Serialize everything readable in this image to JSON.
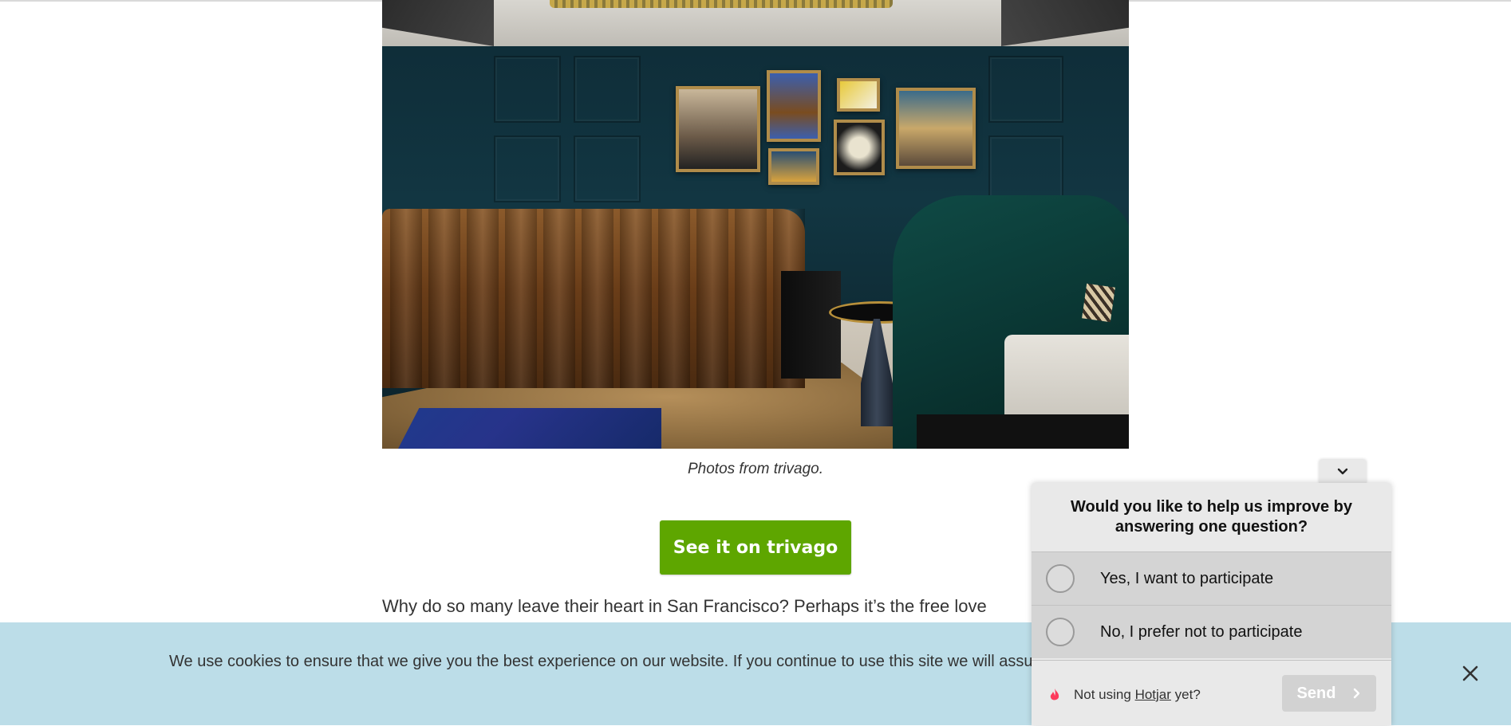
{
  "article": {
    "photo_caption": "Photos from trivago.",
    "cta_label": "See it on trivago",
    "paragraph_text": "Why do so many leave their heart in San Francisco? Perhaps it’s the free love"
  },
  "cookie_banner": {
    "text": "We use cookies to ensure that we give you the best experience on our website. If you continue to use this site we will assume that you are happy with it.",
    "close_icon": "close-icon"
  },
  "hotjar": {
    "toggle_icon": "chevron-down-icon",
    "question": "Would you like to help us improve by answering one question?",
    "options": [
      {
        "label": "Yes, I want to participate"
      },
      {
        "label": "No, I prefer not to participate"
      }
    ],
    "footer_prefix": "Not using",
    "footer_link": "Hotjar",
    "footer_suffix": "yet?",
    "send_label": "Send",
    "send_icon": "chevron-right-icon"
  },
  "colors": {
    "cta_green": "#5ea600",
    "cookie_bg": "#bcdde8",
    "widget_bg": "#e9e9e9",
    "hotjar_brand": "#fd3a5c"
  }
}
